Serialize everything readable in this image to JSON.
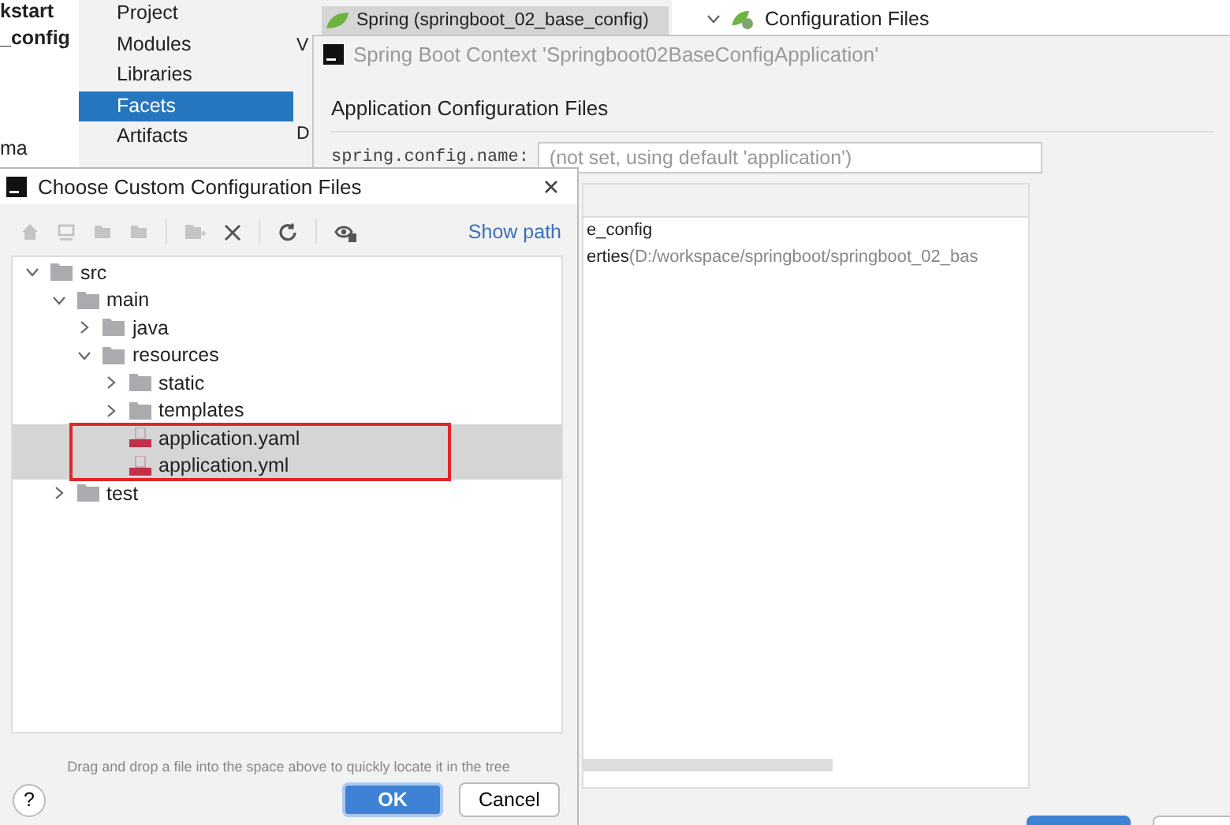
{
  "background": {
    "left_lines": [
      "kstart",
      "_config",
      "ma"
    ],
    "settings_sidebar": [
      {
        "label": "Project",
        "selected": false
      },
      {
        "label": "Modules",
        "selected": false
      },
      {
        "label": "Libraries",
        "selected": false
      },
      {
        "label": "Facets",
        "selected": true
      },
      {
        "label": "Artifacts",
        "selected": false
      }
    ],
    "facet_row": {
      "label": "Spring (springboot_02_base_config)",
      "selected": true
    },
    "middle_letters": [
      "V",
      "D"
    ],
    "right_tree_item": {
      "label": "Configuration Files",
      "expanded": true
    }
  },
  "context_dialog": {
    "title": "Spring Boot Context 'Springboot02BaseConfigApplication'",
    "section": "Application Configuration Files",
    "name_label": "spring.config.name:",
    "name_placeholder": "(not set, using default 'application')",
    "files": [
      {
        "name": "e_config"
      },
      {
        "name": "erties",
        "path": "(D:/workspace/springboot/springboot_02_bas"
      }
    ]
  },
  "choose_dialog": {
    "title": "Choose Custom Configuration Files",
    "show_path": "Show path",
    "tree": [
      {
        "label": "src",
        "kind": "folder",
        "expanded": true,
        "selected": false,
        "children": [
          {
            "label": "main",
            "kind": "folder",
            "expanded": true,
            "selected": false,
            "children": [
              {
                "label": "java",
                "kind": "folder",
                "expanded": false,
                "selected": false
              },
              {
                "label": "resources",
                "kind": "folder",
                "expanded": true,
                "selected": false,
                "children": [
                  {
                    "label": "static",
                    "kind": "folder",
                    "expanded": false,
                    "selected": false
                  },
                  {
                    "label": "templates",
                    "kind": "folder",
                    "expanded": false,
                    "selected": false
                  },
                  {
                    "label": "application.yaml",
                    "kind": "yaml",
                    "selected": true,
                    "highlighted": true
                  },
                  {
                    "label": "application.yml",
                    "kind": "yaml",
                    "selected": true,
                    "highlighted": true
                  }
                ]
              }
            ]
          },
          {
            "label": "test",
            "kind": "folder",
            "expanded": false,
            "selected": false
          }
        ]
      }
    ],
    "hint": "Drag and drop a file into the space above to quickly locate it in the tree",
    "help": "?",
    "ok": "OK",
    "cancel": "Cancel"
  }
}
